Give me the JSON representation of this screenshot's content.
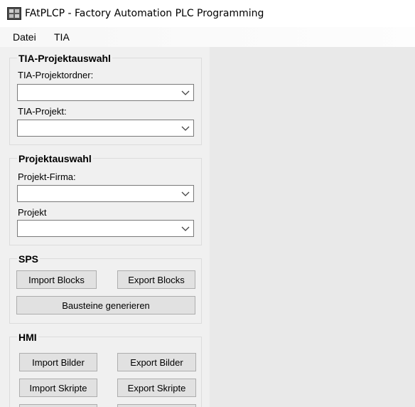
{
  "window": {
    "title": "FAtPLCP - Factory Automation PLC Programming",
    "icon": "fatplcp-app-icon"
  },
  "menu": {
    "items": [
      "Datei",
      "TIA"
    ]
  },
  "tia_group": {
    "title": "TIA-Projektauswahl",
    "folder_label": "TIA-Projektordner:",
    "folder_value": "",
    "project_label": "TIA-Projekt:",
    "project_value": ""
  },
  "project_group": {
    "title": "Projektauswahl",
    "company_label": "Projekt-Firma:",
    "company_value": "",
    "project_label": "Projekt",
    "project_value": ""
  },
  "sps_group": {
    "title": "SPS",
    "import_label": "Import Blocks",
    "export_label": "Export Blocks",
    "generate_label": "Bausteine generieren"
  },
  "hmi_group": {
    "title": "HMI",
    "import_images_label": "Import Bilder",
    "export_images_label": "Export Bilder",
    "import_scripts_label": "Import Skripte",
    "export_scripts_label": "Export Skripte"
  }
}
